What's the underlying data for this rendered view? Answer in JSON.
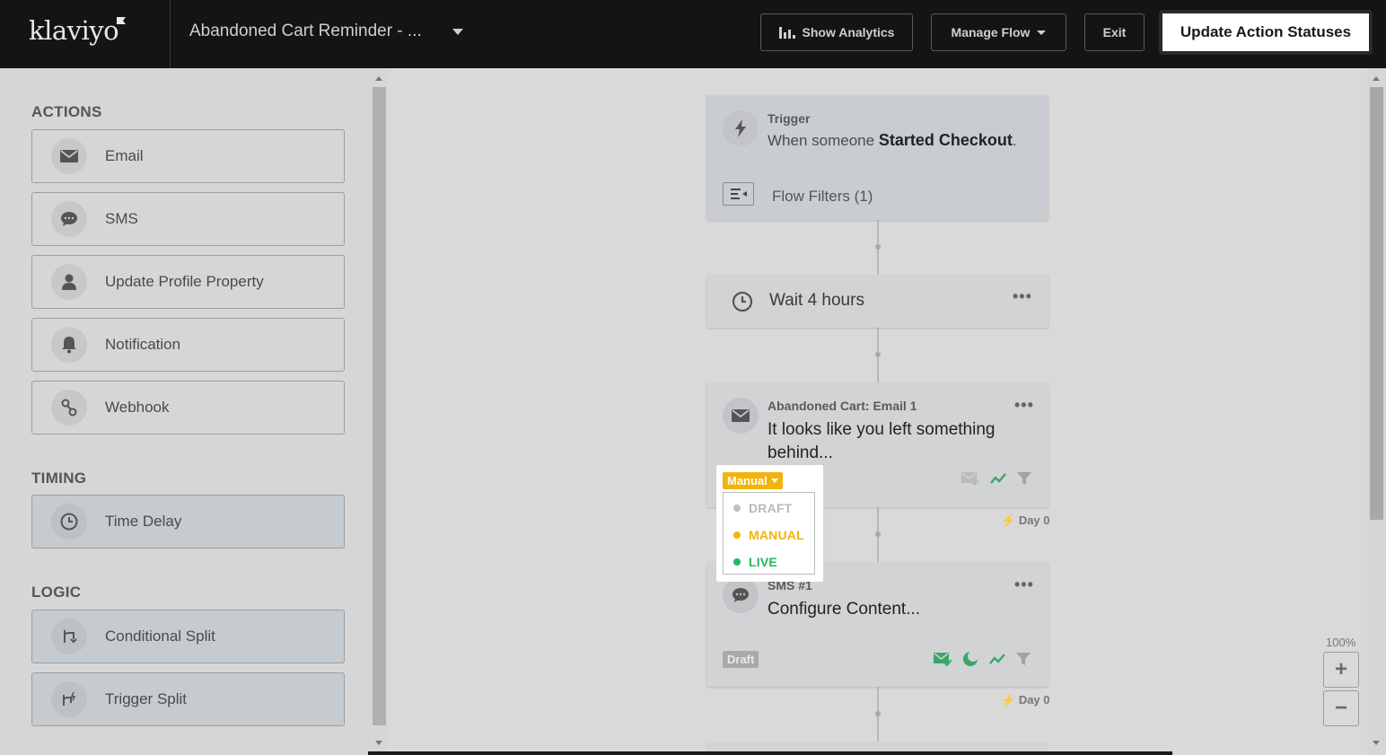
{
  "header": {
    "logo": "klaviyo",
    "flow_name": "Abandoned Cart Reminder - ...",
    "show_analytics": "Show Analytics",
    "manage_flow": "Manage Flow",
    "exit": "Exit",
    "update_statuses": "Update Action Statuses"
  },
  "sidebar": {
    "actions_title": "ACTIONS",
    "actions": [
      {
        "label": "Email",
        "icon": "envelope-icon"
      },
      {
        "label": "SMS",
        "icon": "chat-bubble-icon"
      },
      {
        "label": "Update Profile Property",
        "icon": "person-icon"
      },
      {
        "label": "Notification",
        "icon": "bell-icon"
      },
      {
        "label": "Webhook",
        "icon": "webhook-icon"
      }
    ],
    "timing_title": "TIMING",
    "timing": [
      {
        "label": "Time Delay",
        "icon": "clock-icon"
      }
    ],
    "logic_title": "LOGIC",
    "logic": [
      {
        "label": "Conditional Split",
        "icon": "split-icon"
      },
      {
        "label": "Trigger Split",
        "icon": "trigger-split-icon"
      }
    ]
  },
  "flow": {
    "trigger": {
      "label": "Trigger",
      "text_prefix": "When someone",
      "event": "Started Checkout",
      "text_suffix": ".",
      "filters": "Flow Filters (1)"
    },
    "wait": {
      "label": "Wait 4 hours"
    },
    "email": {
      "label": "Abandoned Cart: Email 1",
      "title": "It looks like you left something behind...",
      "day": "Day 0"
    },
    "sms": {
      "label": "SMS #1",
      "title": "Configure Content...",
      "status": "Draft",
      "day": "Day 0"
    }
  },
  "status_dropdown": {
    "current": "Manual",
    "options": [
      {
        "label": "DRAFT",
        "color": "#b8b8b8"
      },
      {
        "label": "MANUAL",
        "color": "#f2b40c"
      },
      {
        "label": "LIVE",
        "color": "#1fba5a"
      }
    ]
  },
  "zoom": {
    "level": "100%",
    "plus": "+",
    "minus": "−"
  },
  "colors": {
    "accent_manual": "#f2b40c",
    "accent_live": "#1fba5a",
    "header_bg": "#141414"
  }
}
